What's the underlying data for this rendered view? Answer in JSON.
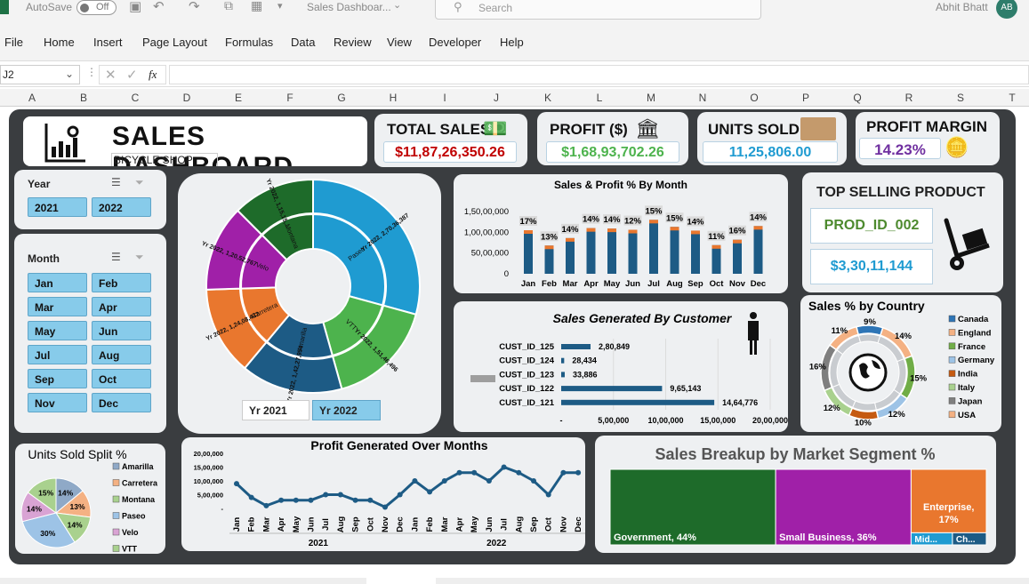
{
  "titlebar": {
    "autosave": "AutoSave",
    "toggle": "Off",
    "doc_title": "Sales Dashboar...",
    "search_placeholder": "Search",
    "user_name": "Abhit Bhatt",
    "user_initials": "AB"
  },
  "menu": [
    "File",
    "Home",
    "Insert",
    "Page Layout",
    "Formulas",
    "Data",
    "Review",
    "View",
    "Developer",
    "Help"
  ],
  "formula": {
    "namebox": "J2",
    "fx": "fx",
    "value": ""
  },
  "columns": [
    "A",
    "B",
    "C",
    "D",
    "E",
    "F",
    "G",
    "H",
    "I",
    "J",
    "K",
    "L",
    "M",
    "N",
    "O",
    "P",
    "Q",
    "R",
    "S",
    "T"
  ],
  "header": {
    "title": "SALES  DASHBOARD",
    "subtitle": "BICYCLE SHOP"
  },
  "kpis": {
    "total_sales": {
      "label": "TOTAL SALES",
      "value": "$11,87,26,350.26",
      "color": "#c00000"
    },
    "profit": {
      "label": "PROFIT ($)",
      "value": "$1,68,93,702.26",
      "color": "#4db34d"
    },
    "units": {
      "label": "UNITS SOLD",
      "value": "11,25,806.00",
      "color": "#1f9bd1"
    },
    "margin": {
      "label": "PROFIT MARGIN",
      "value": "14.23%",
      "color": "#7030a0"
    }
  },
  "slicer_year": {
    "title": "Year",
    "items": [
      "2021",
      "2022"
    ]
  },
  "slicer_month": {
    "title": "Month",
    "items": [
      "Jan",
      "Feb",
      "Mar",
      "Apr",
      "May",
      "Jun",
      "Jul",
      "Aug",
      "Sep",
      "Oct",
      "Nov",
      "Dec"
    ]
  },
  "sunburst_legend": {
    "y2021": "Yr 2021",
    "y2022": "Yr 2022"
  },
  "top_product": {
    "title": "TOP SELLING PRODUCT",
    "product": "PROD_ID_002",
    "value": "$3,30,11,144"
  },
  "colors": {
    "board": "#3a3d40",
    "bar": "#1d5b85",
    "bar_top": "#e9772e",
    "kpi_border": "#b9d2e3"
  },
  "chart_data": [
    {
      "type": "bar",
      "title": "Sales & Profit % By Month",
      "categories": [
        "Jan",
        "Feb",
        "Mar",
        "Apr",
        "May",
        "Jun",
        "Jul",
        "Aug",
        "Sep",
        "Oct",
        "Nov",
        "Dec"
      ],
      "series": [
        {
          "values": [
            10500000,
            6800000,
            8600000,
            11000000,
            10900000,
            10600000,
            13000000,
            11300000,
            10400000,
            6900000,
            8200000,
            11500000
          ]
        }
      ],
      "data_labels": [
        "17%",
        "13%",
        "14%",
        "14%",
        "14%",
        "12%",
        "15%",
        "15%",
        "14%",
        "11%",
        "16%",
        "14%"
      ],
      "y_ticks": [
        "0",
        "50,00,000",
        "1,00,00,000",
        "1,50,00,000"
      ],
      "ylim": [
        0,
        15000000
      ]
    },
    {
      "type": "bar",
      "title": "Sales Generated By Customer",
      "categories": [
        "CUST_ID_125",
        "CUST_ID_124",
        "CUST_ID_123",
        "CUST_ID_122",
        "CUST_ID_121"
      ],
      "values": [
        280849,
        28434,
        33886,
        965143,
        1464776
      ],
      "data_labels": [
        "2,80,849",
        "28,434",
        "33,886",
        "9,65,143",
        "14,64,776"
      ],
      "x_ticks": [
        "-",
        "5,00,000",
        "10,00,000",
        "15,00,000",
        "20,00,000"
      ],
      "xlim": [
        0,
        2000000
      ]
    },
    {
      "type": "pie",
      "title": "Sales % by Country",
      "categories": [
        "Canada",
        "England",
        "France",
        "Germany",
        "India",
        "Italy",
        "Japan",
        "USA"
      ],
      "values": [
        9,
        14,
        15,
        12,
        10,
        12,
        16,
        11
      ],
      "data_labels": [
        "9%",
        "14%",
        "15%",
        "12%",
        "10%",
        "12%",
        "16%",
        "11%"
      ],
      "colors": [
        "#2e75b6",
        "#f4b183",
        "#70ad47",
        "#9dc3e6",
        "#c55a11",
        "#a9d18e",
        "#7f7f7f",
        "#f4b183"
      ]
    },
    {
      "type": "pie",
      "title": "Units Sold Split %",
      "categories": [
        "Amarilla",
        "Carretera",
        "Montana",
        "Paseo",
        "Velo",
        "VTT"
      ],
      "values": [
        14,
        13,
        14,
        30,
        14,
        15
      ],
      "data_labels": [
        "14%",
        "13%",
        "14%",
        "30%",
        "14%",
        "15%"
      ],
      "colors": [
        "#8fa9c7",
        "#f4b183",
        "#a9d18e",
        "#9dc3e6",
        "#d9a3d4",
        "#a9d18e"
      ]
    },
    {
      "type": "line",
      "title": "Profit Generated Over Months",
      "x": [
        "Jan",
        "Feb",
        "Mar",
        "Apr",
        "May",
        "Jun",
        "Jul",
        "Aug",
        "Sep",
        "Oct",
        "Nov",
        "Dec",
        "Jan",
        "Feb",
        "Mar",
        "Apr",
        "May",
        "Jun",
        "Jul",
        "Aug",
        "Sep",
        "Oct",
        "Nov",
        "Dec"
      ],
      "groups": [
        "2021",
        "2022"
      ],
      "values": [
        900000,
        400000,
        100000,
        300000,
        300000,
        300000,
        500000,
        500000,
        300000,
        300000,
        50000,
        500000,
        1000000,
        600000,
        1000000,
        1300000,
        1300000,
        1000000,
        1500000,
        1300000,
        1000000,
        500000,
        1300000,
        1300000
      ],
      "y_ticks": [
        "-",
        "5,00,000",
        "10,00,000",
        "15,00,000",
        "20,00,000"
      ],
      "ylim": [
        0,
        2000000
      ]
    },
    {
      "type": "heatmap",
      "title": "Sales Breakup by Market Segment %",
      "categories": [
        "Government",
        "Small Business",
        "Enterprise",
        "Mid...",
        "Ch..."
      ],
      "values": [
        44,
        36,
        17,
        2,
        1
      ],
      "labels": [
        "Government, 44%",
        "Small Business, 36%",
        "Enterprise, 17%",
        "Mid...",
        "Ch..."
      ]
    },
    {
      "type": "pie",
      "title": "",
      "categories": [
        "Paseo",
        "VTT",
        "Amarilla",
        "Carretera",
        "Velo",
        "Montana"
      ],
      "labels": [
        "Paseo",
        "VTT",
        "Amarilla",
        "Carretera",
        "Velo",
        "Montana"
      ],
      "outer_labels": [
        "Yr 2022, 2,70,36,387",
        "Yr 2022, 1,51,46,496",
        "Yr 2022, 1,42,27,954",
        "Yr 2022, 1,24,08,442",
        "Yr 2022, 1,20,52,767",
        "Yr 2022, 1,15,15,..."
      ],
      "values": [
        27036387,
        15146496,
        14227954,
        12408442,
        12052767,
        11515000
      ]
    }
  ]
}
